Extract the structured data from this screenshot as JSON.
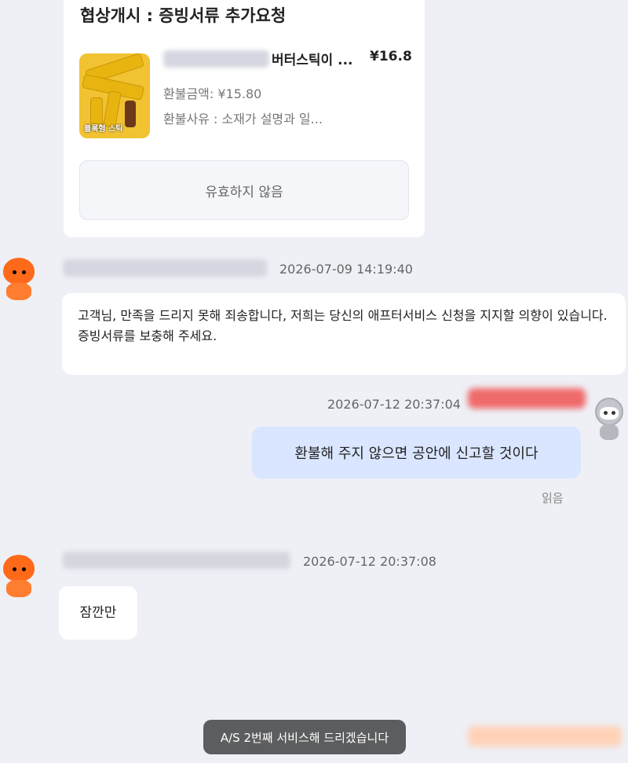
{
  "negotiation_card": {
    "title": "협상개시 : 증빙서류 추가요청",
    "thumb_caption": "블록형 스틱",
    "product_name": "버터스틱이 ...",
    "product_price": "¥16.8",
    "refund_amount": "환불금액: ¥15.80",
    "refund_reason": "환불사유 : 소재가 설명과 일...",
    "status_button": "유효하지 않음"
  },
  "messages": [
    {
      "timestamp": "2026-07-09 14:19:40",
      "text": "고객님, 만족을 드리지 못해 죄송합니다, 저희는 당신의 애프터서비스 신청을 지지할 의향이 있습니다. 증빙서류를 보충해 주세요."
    },
    {
      "timestamp": "2026-07-12 20:37:04",
      "text": "환불해 주지 않으면 공안에 신고할 것이다",
      "status": "읽음"
    },
    {
      "timestamp": "2026-07-12 20:37:08",
      "text": "잠깐만"
    }
  ],
  "toast": "A/S 2번째 서비스해 드리겠습니다",
  "colors": {
    "background": "#eef0f6",
    "my_bubble": "#dae6ff",
    "agent_avatar": "#ff6a1a"
  }
}
